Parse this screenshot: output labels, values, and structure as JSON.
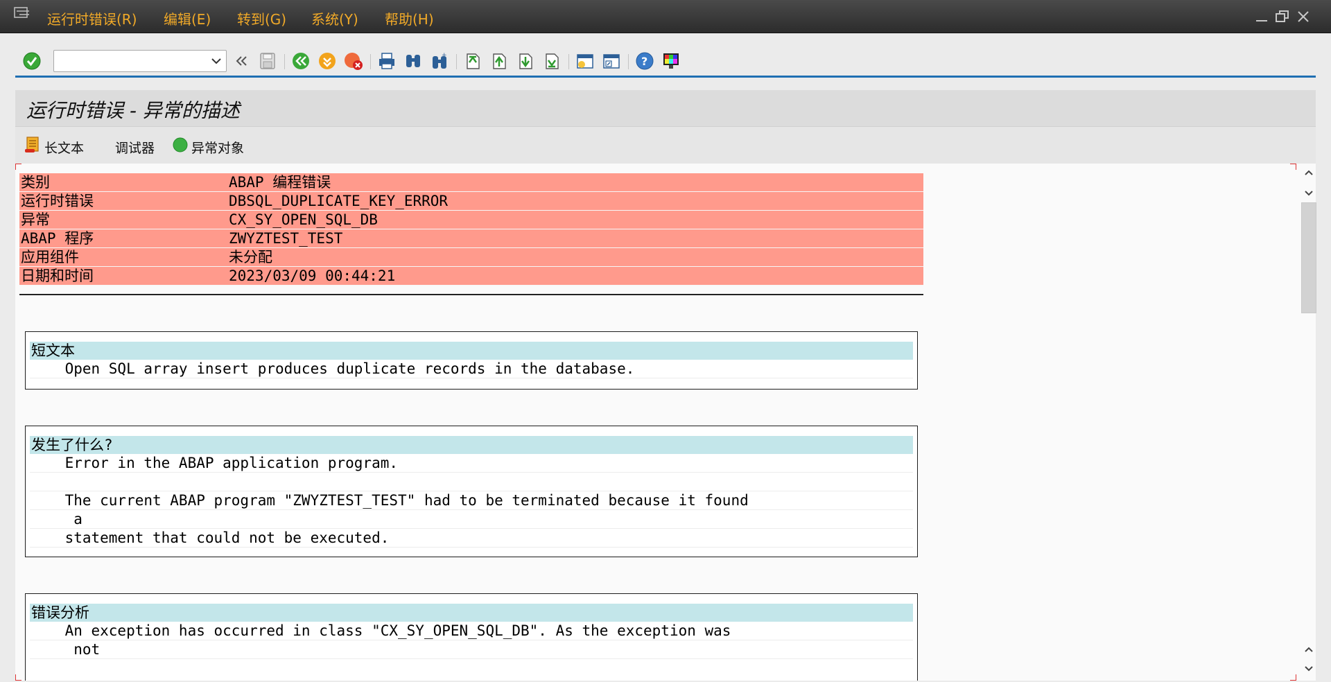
{
  "menubar": {
    "items": [
      {
        "label": "运行时错误(R)"
      },
      {
        "label": "编辑(E)"
      },
      {
        "label": "转到(G)"
      },
      {
        "label": "系统(Y)"
      },
      {
        "label": "帮助(H)"
      }
    ]
  },
  "toolbar": {
    "command_field": {
      "value": "",
      "placeholder": ""
    },
    "icons": [
      "enter-check-icon",
      "command-dropdown-icon",
      "collapse-toolbar-icon",
      "save-icon",
      "back-icon",
      "exit-icon",
      "cancel-icon",
      "print-icon",
      "find-icon",
      "find-next-icon",
      "first-page-icon",
      "previous-page-icon",
      "next-page-icon",
      "last-page-icon",
      "create-session-icon",
      "generate-shortcut-icon",
      "help-icon",
      "customize-layout-icon"
    ]
  },
  "page": {
    "title": "运行时错误 - 异常的描述"
  },
  "app_toolbar": {
    "long_text": "长文本",
    "debugger": "调试器",
    "exception_object": "异常对象"
  },
  "header": {
    "rows": [
      {
        "key": "类别",
        "value": "ABAP 编程错误"
      },
      {
        "key": "运行时错误",
        "value": "DBSQL_DUPLICATE_KEY_ERROR"
      },
      {
        "key": "异常",
        "value": "CX_SY_OPEN_SQL_DB"
      },
      {
        "key": "ABAP 程序",
        "value": "ZWYZTEST_TEST"
      },
      {
        "key": "应用组件",
        "value": "未分配"
      },
      {
        "key": "日期和时间",
        "value": "2023/03/09 00:44:21"
      }
    ]
  },
  "sections": {
    "short_text": {
      "title": "短文本",
      "lines": [
        "    Open SQL array insert produces duplicate records in the database."
      ]
    },
    "what_happened": {
      "title": "发生了什么?",
      "lines": [
        "    Error in the ABAP application program.",
        "",
        "    The current ABAP program \"ZWYZTEST_TEST\" had to be terminated because it found",
        "     a",
        "    statement that could not be executed."
      ]
    },
    "error_analysis": {
      "title": "错误分析",
      "lines": [
        "    An exception has occurred in class \"CX_SY_OPEN_SQL_DB\". As the exception was",
        "     not"
      ]
    }
  },
  "colors": {
    "menu_text": "#f0a928",
    "header_bg": "#ff9a8c",
    "section_title_bg": "#c3e6ea",
    "toolbar_rule": "#1f6fb2"
  }
}
